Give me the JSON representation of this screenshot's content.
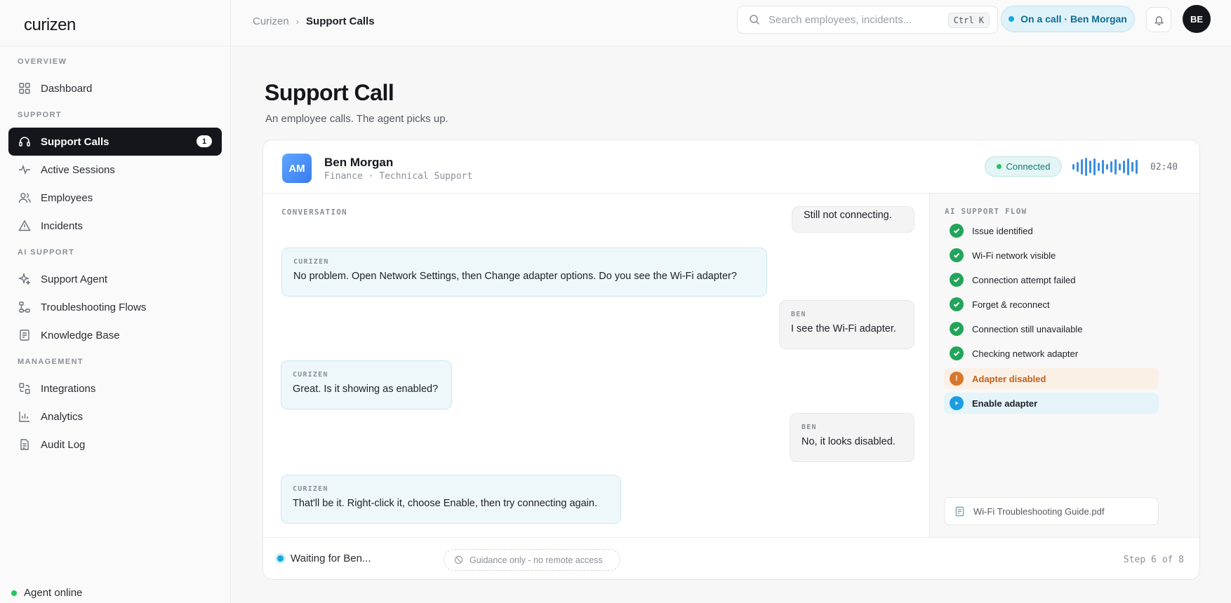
{
  "app": {
    "logo": "curizen"
  },
  "sidebar": {
    "sections": {
      "overview": "OVERVIEW",
      "support": "SUPPORT",
      "ai_support": "AI SUPPORT",
      "management": "MANAGEMENT"
    },
    "items": {
      "dashboard": {
        "label": "Dashboard",
        "icon": "grid-icon"
      },
      "support_calls": {
        "label": "Support Calls",
        "icon": "headset-icon",
        "badge": "1",
        "active": true
      },
      "active_sessions": {
        "label": "Active Sessions",
        "icon": "pulse-icon"
      },
      "employees": {
        "label": "Employees",
        "icon": "users-icon"
      },
      "incidents": {
        "label": "Incidents",
        "icon": "warning-icon"
      },
      "support_agent": {
        "label": "Support Agent",
        "icon": "sparkle-icon"
      },
      "troubleshooting_flows": {
        "label": "Troubleshooting Flows",
        "icon": "flow-icon"
      },
      "knowledge_base": {
        "label": "Knowledge Base",
        "icon": "book-icon"
      },
      "integrations": {
        "label": "Integrations",
        "icon": "integrations-icon"
      },
      "analytics": {
        "label": "Analytics",
        "icon": "chart-icon"
      },
      "audit_log": {
        "label": "Audit Log",
        "icon": "document-icon"
      }
    },
    "agent_status": "Agent online",
    "status_color": "#22c55e"
  },
  "topbar": {
    "breadcrumb": {
      "root": "Curizen",
      "current": "Support Calls"
    },
    "search": {
      "placeholder": "Search employees, incidents...",
      "shortcut": "Ctrl K"
    },
    "call_status": "On a call · Ben Morgan",
    "user_initials": "BE"
  },
  "page": {
    "title": "Support Call",
    "subtitle": "An employee calls. The agent picks up."
  },
  "call": {
    "avatar_initials": "AM",
    "caller_name": "Ben Morgan",
    "caller_meta": "Finance · Technical Support",
    "status": "Connected",
    "timer": "02:40",
    "accent": "#3b8fe0"
  },
  "conversation": {
    "label": "CONVERSATION",
    "messages": [
      {
        "from": "",
        "text": "Still not connecting."
      },
      {
        "from": "CURIZEN",
        "text": "No problem. Open Network Settings, then Change adapter options. Do you see the Wi-Fi adapter?"
      },
      {
        "from": "BEN",
        "text": "I see the Wi-Fi adapter."
      },
      {
        "from": "CURIZEN",
        "text": "Great. Is it showing as enabled?"
      },
      {
        "from": "BEN",
        "text": "No, it looks disabled."
      },
      {
        "from": "CURIZEN",
        "text": "That'll be it. Right-click it, choose Enable, then try connecting again."
      }
    ]
  },
  "flow": {
    "label": "AI SUPPORT FLOW",
    "steps": [
      {
        "label": "Issue identified",
        "state": "done"
      },
      {
        "label": "Wi-Fi network visible",
        "state": "done"
      },
      {
        "label": "Connection attempt failed",
        "state": "done"
      },
      {
        "label": "Forget & reconnect",
        "state": "done"
      },
      {
        "label": "Connection still unavailable",
        "state": "done"
      },
      {
        "label": "Checking network adapter",
        "state": "done"
      },
      {
        "label": "Adapter disabled",
        "state": "warning"
      },
      {
        "label": "Enable adapter",
        "state": "current"
      }
    ],
    "document": "Wi-Fi Troubleshooting Guide.pdf"
  },
  "footer": {
    "waiting": "Waiting for Ben...",
    "guidance": "Guidance only - no remote access",
    "step_counter": "Step 6 of 8"
  }
}
